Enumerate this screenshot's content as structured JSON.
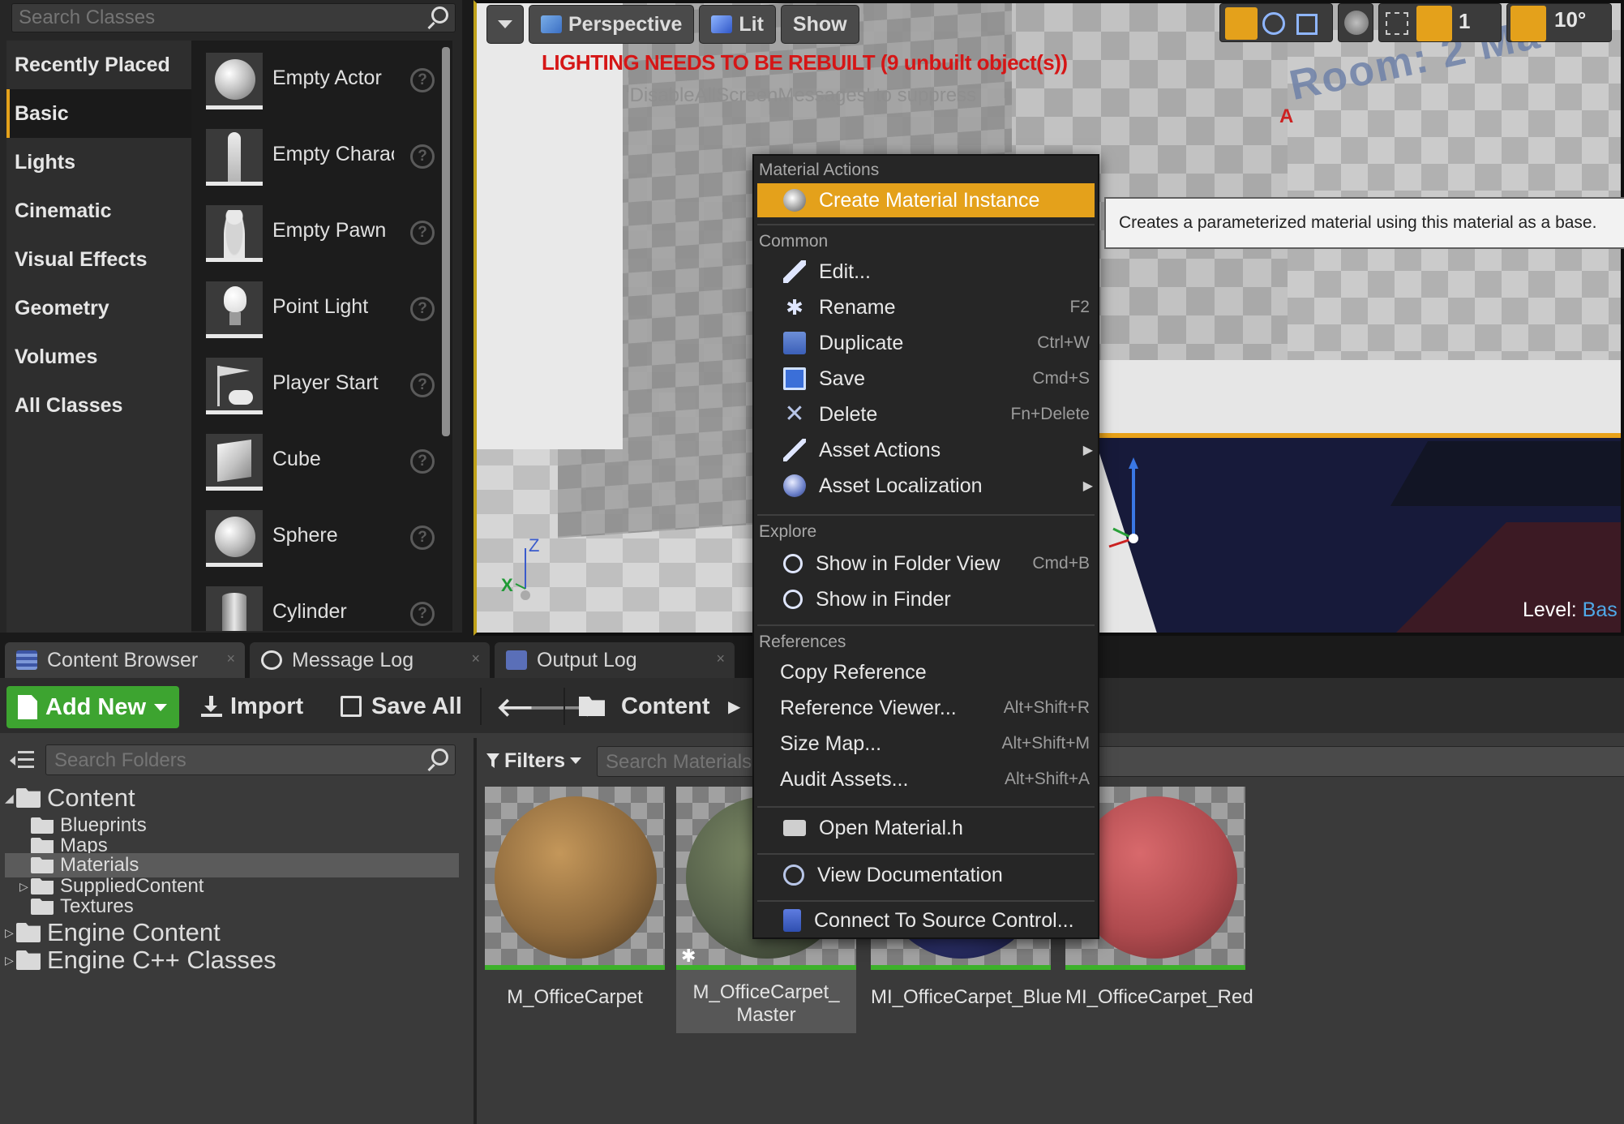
{
  "place_panel": {
    "search_placeholder": "Search Classes",
    "categories": [
      {
        "label": "Recently Placed",
        "active": false
      },
      {
        "label": "Basic",
        "active": true
      },
      {
        "label": "Lights",
        "active": false
      },
      {
        "label": "Cinematic",
        "active": false
      },
      {
        "label": "Visual Effects",
        "active": false
      },
      {
        "label": "Geometry",
        "active": false
      },
      {
        "label": "Volumes",
        "active": false
      },
      {
        "label": "All Classes",
        "active": false
      }
    ],
    "actors": [
      {
        "label": "Empty Actor",
        "icon": "sphere-icon"
      },
      {
        "label": "Empty Character",
        "icon": "character-icon"
      },
      {
        "label": "Empty Pawn",
        "icon": "pawn-icon"
      },
      {
        "label": "Point Light",
        "icon": "bulb-icon"
      },
      {
        "label": "Player Start",
        "icon": "player-start-icon"
      },
      {
        "label": "Cube",
        "icon": "cube-icon"
      },
      {
        "label": "Sphere",
        "icon": "sphere-icon"
      },
      {
        "label": "Cylinder",
        "icon": "cylinder-icon"
      }
    ],
    "help_glyph": "?"
  },
  "viewport": {
    "toolbar": {
      "perspective": "Perspective",
      "lit": "Lit",
      "show": "Show",
      "grid_snap": "1",
      "rotation_snap": "10°"
    },
    "lighting_warning": "LIGHTING NEEDS TO BE REBUILT (9 unbuilt object(s))",
    "suppress_hint": "'DisableAllScreenMessages' to suppress",
    "room_text": "Room: 2 Ma",
    "room_marker": "A",
    "axis_z": "Z",
    "axis_x": "X",
    "level_label": "Level:",
    "level_value": "Bas",
    "colors": {
      "warning": "#d51616",
      "selection": "#e4a11b"
    }
  },
  "tabs": [
    {
      "label": "Content Browser",
      "active": true,
      "icon": "content-browser-icon"
    },
    {
      "label": "Message Log",
      "active": false,
      "icon": "message-log-icon"
    },
    {
      "label": "Output Log",
      "active": false,
      "icon": "output-log-icon"
    }
  ],
  "tab_close_glyph": "×",
  "content_browser": {
    "add_new": "Add New",
    "import": "Import",
    "save_all": "Save All",
    "path_root": "Content",
    "folder_search_placeholder": "Search Folders",
    "filters": "Filters",
    "asset_search_placeholder": "Search Materials",
    "tree": [
      {
        "label": "Content",
        "level": 0,
        "expanded": true,
        "selected": false
      },
      {
        "label": "Blueprints",
        "level": 1,
        "expanded": false,
        "selected": false
      },
      {
        "label": "Maps",
        "level": 1,
        "expanded": false,
        "selected": false
      },
      {
        "label": "Materials",
        "level": 1,
        "expanded": false,
        "selected": true
      },
      {
        "label": "SuppliedContent",
        "level": 1,
        "expanded": false,
        "selected": false,
        "collapsible": true
      },
      {
        "label": "Textures",
        "level": 1,
        "expanded": false,
        "selected": false
      },
      {
        "label": "Engine Content",
        "level": 0,
        "expanded": false,
        "selected": false
      },
      {
        "label": "Engine C++ Classes",
        "level": 0,
        "expanded": false,
        "selected": false
      }
    ],
    "assets": [
      {
        "label": "M_OfficeCarpet",
        "color": "#a27a45",
        "selected": false
      },
      {
        "label": "M_OfficeCarpet_\nMaster",
        "color": "#5e6a4e",
        "selected": true
      },
      {
        "label": "MI_OfficeCarpet_Blue",
        "color": "#2e3370",
        "selected": false
      },
      {
        "label": "MI_OfficeCarpet_Red",
        "color": "#c05558",
        "selected": false
      }
    ]
  },
  "context_menu": {
    "sections": {
      "material_actions": "Material Actions",
      "common": "Common",
      "explore": "Explore",
      "references": "References"
    },
    "create_material_instance": "Create Material Instance",
    "edit": "Edit...",
    "rename": "Rename",
    "rename_shortcut": "F2",
    "duplicate": "Duplicate",
    "duplicate_shortcut": "Ctrl+W",
    "save": "Save",
    "save_shortcut": "Cmd+S",
    "delete": "Delete",
    "delete_shortcut": "Fn+Delete",
    "asset_actions": "Asset Actions",
    "asset_localization": "Asset Localization",
    "show_in_folder_view": "Show in Folder View",
    "show_in_folder_view_shortcut": "Cmd+B",
    "show_in_finder": "Show in Finder",
    "copy_reference": "Copy Reference",
    "reference_viewer": "Reference Viewer...",
    "reference_viewer_shortcut": "Alt+Shift+R",
    "size_map": "Size Map...",
    "size_map_shortcut": "Alt+Shift+M",
    "audit_assets": "Audit Assets...",
    "audit_assets_shortcut": "Alt+Shift+A",
    "open_material_h": "Open Material.h",
    "view_documentation": "View Documentation",
    "connect_source_control": "Connect To Source Control...",
    "submenu_arrow": "▶"
  },
  "tooltip": "Creates a parameterized material using this material as a base."
}
